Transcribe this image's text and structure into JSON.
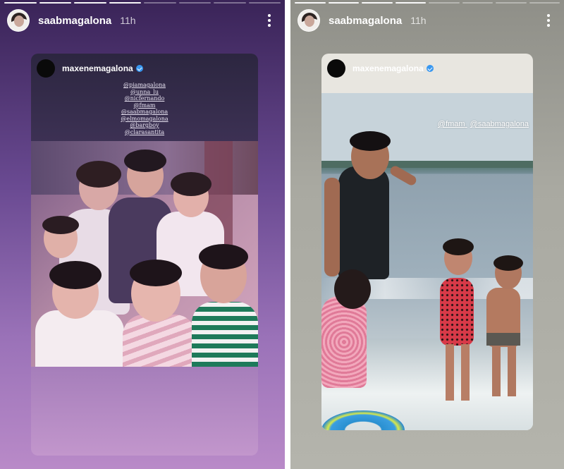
{
  "stories": [
    {
      "username": "saabmagalona",
      "time": "11h",
      "progress": {
        "total": 8,
        "done": 4
      },
      "shared_post": {
        "username": "maxenemagalona",
        "tags": [
          "@piamagalona",
          "@unna_lu",
          "@nicfernando",
          "@fmam",
          "@saabmagalona",
          "@elmomagalona",
          "@bargboy",
          "@clarasantita"
        ]
      }
    },
    {
      "username": "saabmagalona",
      "time": "11h",
      "progress": {
        "total": 8,
        "done": 4
      },
      "shared_post": {
        "username": "maxenemagalona",
        "photo_tags": [
          "@fmam",
          "@saabmagalona"
        ]
      }
    }
  ],
  "icons": {
    "more": "more-vertical-icon",
    "verified": "verified-badge-icon"
  },
  "colors": {
    "verified": "#3897f0",
    "left_bg": "#6a4a92",
    "right_bg": "#a9a9a1"
  }
}
